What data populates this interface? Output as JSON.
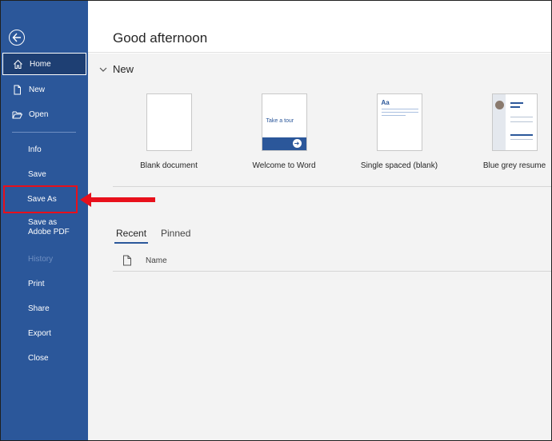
{
  "sidebar": {
    "items": [
      {
        "label": "Home"
      },
      {
        "label": "New"
      },
      {
        "label": "Open"
      },
      {
        "label": "Info"
      },
      {
        "label": "Save"
      },
      {
        "label": "Save As"
      },
      {
        "label": "Save as Adobe PDF"
      },
      {
        "label": "History"
      },
      {
        "label": "Print"
      },
      {
        "label": "Share"
      },
      {
        "label": "Export"
      },
      {
        "label": "Close"
      }
    ],
    "icons": {
      "back": "back-arrow-icon",
      "home": "home-icon",
      "new": "new-document-icon",
      "open": "folder-open-icon"
    }
  },
  "main": {
    "greeting": "Good afternoon",
    "new_section": {
      "title": "New",
      "templates": [
        {
          "label": "Blank document"
        },
        {
          "label": "Welcome to Word",
          "thumb_text": "Take a tour"
        },
        {
          "label": "Single spaced (blank)",
          "thumb_text": "Aa"
        },
        {
          "label": "Blue grey resume"
        }
      ]
    },
    "tabs": [
      {
        "label": "Recent"
      },
      {
        "label": "Pinned"
      }
    ],
    "list": {
      "name_column": "Name"
    }
  },
  "colors": {
    "sidebar": "#2b579a",
    "highlight": "#e8101b",
    "accent": "#2b579a"
  }
}
